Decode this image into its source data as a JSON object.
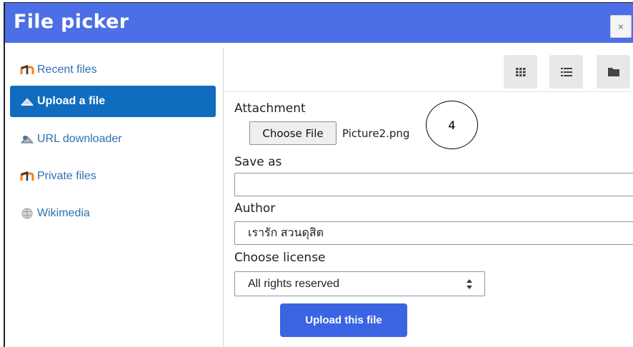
{
  "dialog": {
    "title": "File picker",
    "close_label": "×"
  },
  "sidebar": {
    "items": [
      {
        "label": "Recent files",
        "icon": "moodle-logo-icon",
        "active": false
      },
      {
        "label": "Upload a file",
        "icon": "upload-icon",
        "active": true
      },
      {
        "label": "URL downloader",
        "icon": "url-downloader-icon",
        "active": false
      },
      {
        "label": "Private files",
        "icon": "moodle-logo-icon",
        "active": false
      },
      {
        "label": "Wikimedia",
        "icon": "wikimedia-globe-icon",
        "active": false
      }
    ]
  },
  "toolbar": {
    "buttons": [
      "grid-view-icon",
      "list-view-icon",
      "folder-view-icon"
    ]
  },
  "form": {
    "attachment_label": "Attachment",
    "choose_file_label": "Choose File",
    "selected_file": "Picture2.png",
    "save_as_label": "Save as",
    "save_as_value": "",
    "author_label": "Author",
    "author_value": "เรารัก สวนดุสิต",
    "license_label": "Choose license",
    "license_value": "All rights reserved",
    "upload_label": "Upload this file"
  },
  "annotation": {
    "step_number": "4"
  },
  "colors": {
    "titlebar": "#4c6ee6",
    "active_item": "#0f6cbf",
    "link": "#2f6fb5",
    "upload_button": "#3b64e3"
  }
}
